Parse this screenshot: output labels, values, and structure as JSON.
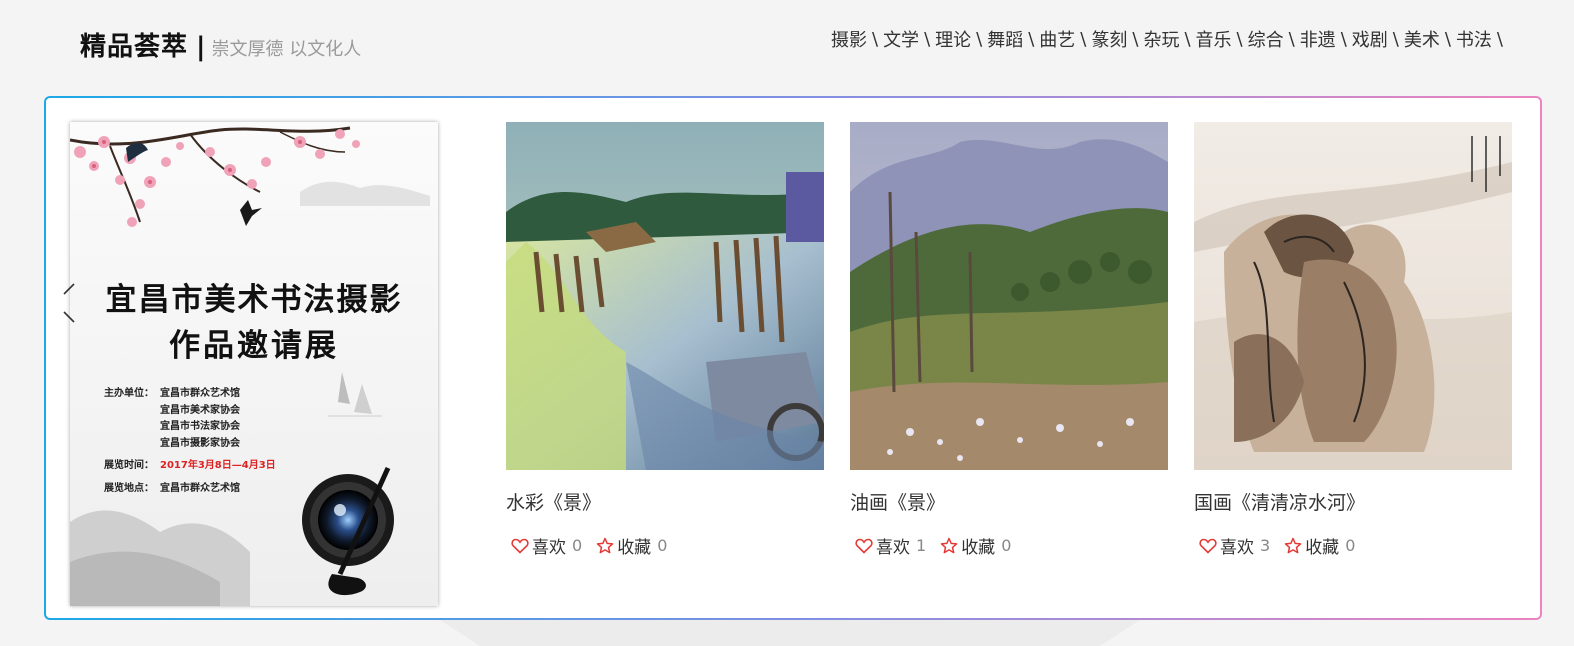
{
  "header": {
    "title": "精品荟萃",
    "divider": "|",
    "subtitle": "崇文厚德 以文化人"
  },
  "categories": [
    {
      "label": "摄影"
    },
    {
      "label": "文学"
    },
    {
      "label": "理论"
    },
    {
      "label": "舞蹈"
    },
    {
      "label": "曲艺"
    },
    {
      "label": "篆刻"
    },
    {
      "label": "杂玩"
    },
    {
      "label": "音乐"
    },
    {
      "label": "综合"
    },
    {
      "label": "非遗"
    },
    {
      "label": "戏剧"
    },
    {
      "label": "美术"
    },
    {
      "label": "书法"
    }
  ],
  "category_separator": "\\",
  "poster": {
    "title_line_1": "宜昌市美术书法摄影",
    "title_line_2": "作品邀请展",
    "organizer_label": "主办单位：",
    "organizers": [
      "宜昌市群众艺术馆",
      "宜昌市美术家协会",
      "宜昌市书法家协会",
      "宜昌市摄影家协会"
    ],
    "time_label": "展览时间：",
    "time_value": "2017年3月8日—4月3日",
    "venue_label": "展览地点：",
    "venue_value": "宜昌市群众艺术馆"
  },
  "artworks": [
    {
      "title": "水彩《景》",
      "like_label": "喜欢",
      "likes": "0",
      "fav_label": "收藏",
      "favorites": "0"
    },
    {
      "title": "油画《景》",
      "like_label": "喜欢",
      "likes": "1",
      "fav_label": "收藏",
      "favorites": "0"
    },
    {
      "title": "国画《清清凉水河》",
      "like_label": "喜欢",
      "likes": "3",
      "fav_label": "收藏",
      "favorites": "0"
    }
  ],
  "colors": {
    "border_start": "#1da9e6",
    "border_end": "#ec84c0",
    "like_red": "#e53935",
    "info_red": "#dd2222"
  },
  "icons": {
    "like": "heart-icon",
    "favorite": "star-icon",
    "prev": "chevron-left-icon",
    "next": "chevron-right-icon"
  }
}
